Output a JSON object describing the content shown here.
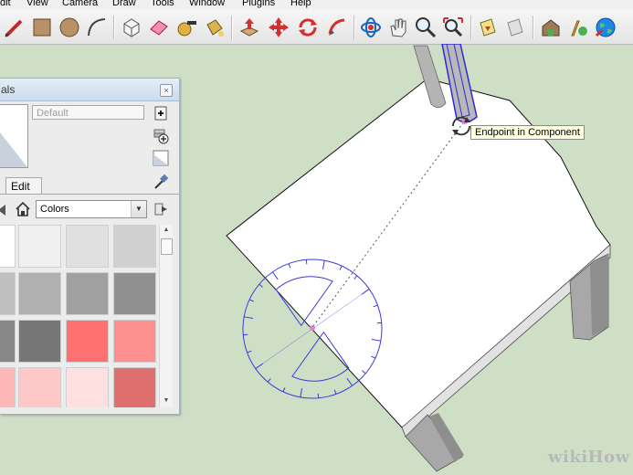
{
  "menu": {
    "items": [
      "dit",
      "View",
      "Camera",
      "Draw",
      "Tools",
      "Window",
      "Plugins",
      "Help"
    ]
  },
  "toolbar": {
    "tools": [
      "pencil-icon",
      "rectangle-icon",
      "circle-icon",
      "arc-icon",
      "make-component-icon",
      "eraser-icon",
      "tape-measure-icon",
      "paint-bucket-icon",
      "push-pull-icon",
      "move-icon",
      "rotate-icon",
      "follow-me-icon",
      "orbit-icon",
      "pan-icon",
      "zoom-icon",
      "zoom-extents-icon",
      "section-icon",
      "display-section-icon",
      "warehouse-icon",
      "share-icon",
      "earth-icon"
    ]
  },
  "viewport": {
    "tooltip": "Endpoint in Component",
    "watermark": "wikiHow"
  },
  "materials": {
    "title": "als",
    "name_placeholder": "Default",
    "tab_edit": "Edit",
    "collection": "Colors",
    "swatch_colors": [
      "#ffffff",
      "#f0f0f0",
      "#e0e0e0",
      "#d0d0d0",
      "#c0c0c0",
      "#b0b0b0",
      "#a0a0a0",
      "#909090",
      "#888888",
      "#777777",
      "#ff7070",
      "#ff9090",
      "#ffb8b8",
      "#ffc8c8",
      "#ffe0e0",
      "#e07070"
    ]
  }
}
